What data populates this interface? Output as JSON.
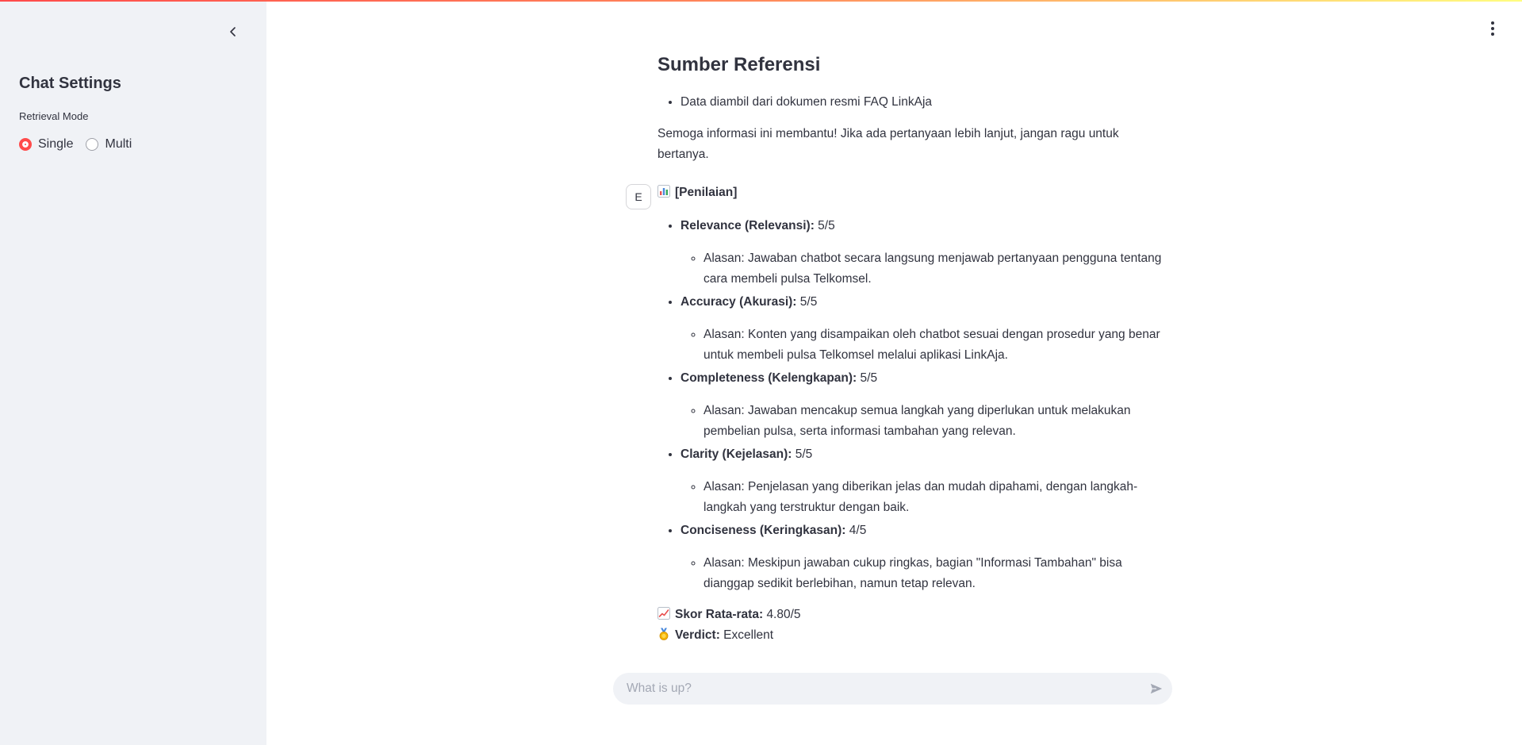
{
  "sidebar": {
    "title": "Chat Settings",
    "retrieval_label": "Retrieval Mode",
    "options": [
      {
        "label": "Single",
        "selected": true
      },
      {
        "label": "Multi",
        "selected": false
      }
    ]
  },
  "answer": {
    "heading": "Sumber Referensi",
    "sources": [
      "Data diambil dari dokumen resmi FAQ LinkAja"
    ],
    "closing": "Semoga informasi ini membantu! Jika ada pertanyaan lebih lanjut, jangan ragu untuk bertanya."
  },
  "evaluation": {
    "avatar": "E",
    "heading": "[Penilaian]",
    "criteria": [
      {
        "name": "Relevance (Relevansi):",
        "score": "5/5",
        "reason": "Alasan: Jawaban chatbot secara langsung menjawab pertanyaan pengguna tentang cara membeli pulsa Telkomsel."
      },
      {
        "name": "Accuracy (Akurasi):",
        "score": "5/5",
        "reason": "Alasan: Konten yang disampaikan oleh chatbot sesuai dengan prosedur yang benar untuk membeli pulsa Telkomsel melalui aplikasi LinkAja."
      },
      {
        "name": "Completeness (Kelengkapan):",
        "score": "5/5",
        "reason": "Alasan: Jawaban mencakup semua langkah yang diperlukan untuk melakukan pembelian pulsa, serta informasi tambahan yang relevan."
      },
      {
        "name": "Clarity (Kejelasan):",
        "score": "5/5",
        "reason": "Alasan: Penjelasan yang diberikan jelas dan mudah dipahami, dengan langkah-langkah yang terstruktur dengan baik."
      },
      {
        "name": "Conciseness (Keringkasan):",
        "score": "4/5",
        "reason": "Alasan: Meskipun jawaban cukup ringkas, bagian \"Informasi Tambahan\" bisa dianggap sedikit berlebihan, namun tetap relevan."
      }
    ],
    "avg_label": "Skor Rata-rata:",
    "avg_value": "4.80/5",
    "verdict_label": "Verdict:",
    "verdict_value": "Excellent"
  },
  "chat_input": {
    "placeholder": "What is up?"
  },
  "colors": {
    "accent": "#ff4b4b",
    "sidebar_bg": "#f0f2f6",
    "text": "#31333f"
  },
  "icons": {
    "collapse": "chevron-left-icon",
    "menu": "more-vertical-icon",
    "send": "send-icon",
    "chart": "bar-chart-emoji-icon",
    "trend": "chart-increasing-emoji-icon",
    "medal": "medal-emoji-icon"
  }
}
